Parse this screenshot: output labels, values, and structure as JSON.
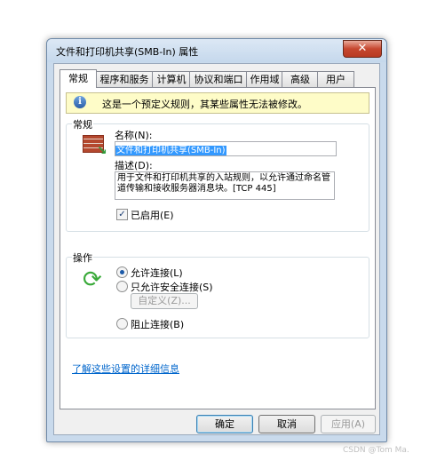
{
  "window": {
    "title": "文件和打印机共享(SMB-In) 属性",
    "close_glyph": "✕"
  },
  "tabs": [
    "常规",
    "程序和服务",
    "计算机",
    "协议和端口",
    "作用域",
    "高级",
    "用户"
  ],
  "info": {
    "icon": "info-icon",
    "text": "这是一个预定义规则，其某些属性无法被修改。"
  },
  "general": {
    "group_title": "常规",
    "name_label": "名称(N):",
    "name_value": "文件和打印机共享(SMB-In)",
    "desc_label": "描述(D):",
    "desc_value": "用于文件和打印机共享的入站规则，以允许通过命名管道传输和接收服务器消息块。[TCP 445]",
    "enabled_label": "已启用(E)",
    "enabled": true
  },
  "action": {
    "group_title": "操作",
    "allow_label": "允许连接(L)",
    "allow_secure_label": "只允许安全连接(S)",
    "customize_label": "自定义(Z)...",
    "block_label": "阻止连接(B)",
    "selected": "allow"
  },
  "help_link": "了解这些设置的详细信息",
  "buttons": {
    "ok": "确定",
    "cancel": "取消",
    "apply": "应用(A)"
  },
  "watermark": "CSDN @Tom Ma."
}
